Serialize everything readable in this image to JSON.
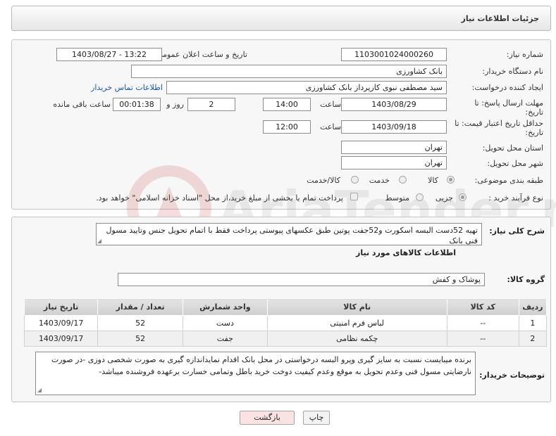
{
  "header": {
    "title": "جزئیات اطلاعات نیاز"
  },
  "form": {
    "need_number": {
      "label": "شماره نیاز:",
      "value": "1103001024000260"
    },
    "announce_datetime": {
      "label": "تاریخ و ساعت اعلان عمومی:",
      "value": "1403/08/27 - 13:22"
    },
    "buyer_org": {
      "label": "نام دستگاه خریدار:",
      "value": "بانک کشاورزی"
    },
    "requester": {
      "label": "ایجاد کننده درخواست:",
      "value": "سید مصطفی نبوی کارپرداز بانک کشاورزی",
      "contact_link": "اطلاعات تماس خریدار"
    },
    "reply_deadline": {
      "label_line1": "مهلت ارسال پاسخ: تا",
      "label_line2": "تاریخ:",
      "date": "1403/08/29",
      "time_label": "ساعت",
      "time": "14:00",
      "days": "2",
      "days_label": "روز و",
      "remaining": "00:01:38",
      "remaining_label": "ساعت باقی مانده"
    },
    "price_validity": {
      "label_line1": "حداقل تاریخ اعتبار قیمت: تا",
      "label_line2": "تاریخ:",
      "date": "1403/09/18",
      "time_label": "ساعت",
      "time": "12:00"
    },
    "province": {
      "label": "استان محل تحویل:",
      "value": "تهران"
    },
    "city": {
      "label": "شهر محل تحویل:",
      "value": "تهران"
    },
    "category": {
      "label": "طبقه بندی موضوعی:",
      "options": [
        "کالا",
        "خدمت",
        "کالا/خدمت"
      ],
      "selected": "کالا"
    },
    "purchase_type": {
      "label": "نوع فرآیند خرید :",
      "options": [
        "جزیی",
        "متوسط"
      ],
      "selected": "جزیی",
      "checkbox_text": "پرداخت تمام یا بخشی از مبلغ خرید،از محل \"اسناد خزانه اسلامی\" خواهد بود."
    }
  },
  "description": {
    "label": "شرح کلی نیاز:",
    "text": "تهیه 52دست البسه اسکورت و52جفت  پوتین طبق عکسهای پیوستی پرداخت فقط با اتمام تحویل جنس وتایید مسول فنی بانک"
  },
  "goods": {
    "section_title": "اطلاعات کالاهای مورد نیاز",
    "group_label": "گروه کالا:",
    "group_value": "پوشاک و کفش",
    "columns": [
      "ردیف",
      "کد کالا",
      "نام کالا",
      "واحد شمارش",
      "تعداد / مقدار",
      "تاریخ نیاز"
    ],
    "rows": [
      [
        "1",
        "--",
        "لباس فرم امنیتی",
        "دست",
        "52",
        "1403/09/17"
      ],
      [
        "2",
        "--",
        "چکمه نظامی",
        "جفت",
        "52",
        "1403/09/17"
      ]
    ]
  },
  "buyer_notes": {
    "label": "توضیحات خریدار:",
    "text": "برنده میبایست نسبت به سایز گیری وپرو البسه درخواستی در محل بانک اقدام نمایداندازه گیری به صورت شخصی دوزی -در صورت نارضایتی مسول فنی وعدم تحویل به موقع وعدم کیفیت دوخت خرید باطل وتمامی خسارت برعهده فروشنده میباشد-"
  },
  "buttons": {
    "print": "چاپ",
    "back": "بازگشت"
  },
  "watermark": {
    "text": "AriaTender.neT"
  },
  "colors": {
    "link": "#1a55b0",
    "back_button_bg": "#fbe3e3",
    "print_button_bg": "#f3f3f3"
  }
}
